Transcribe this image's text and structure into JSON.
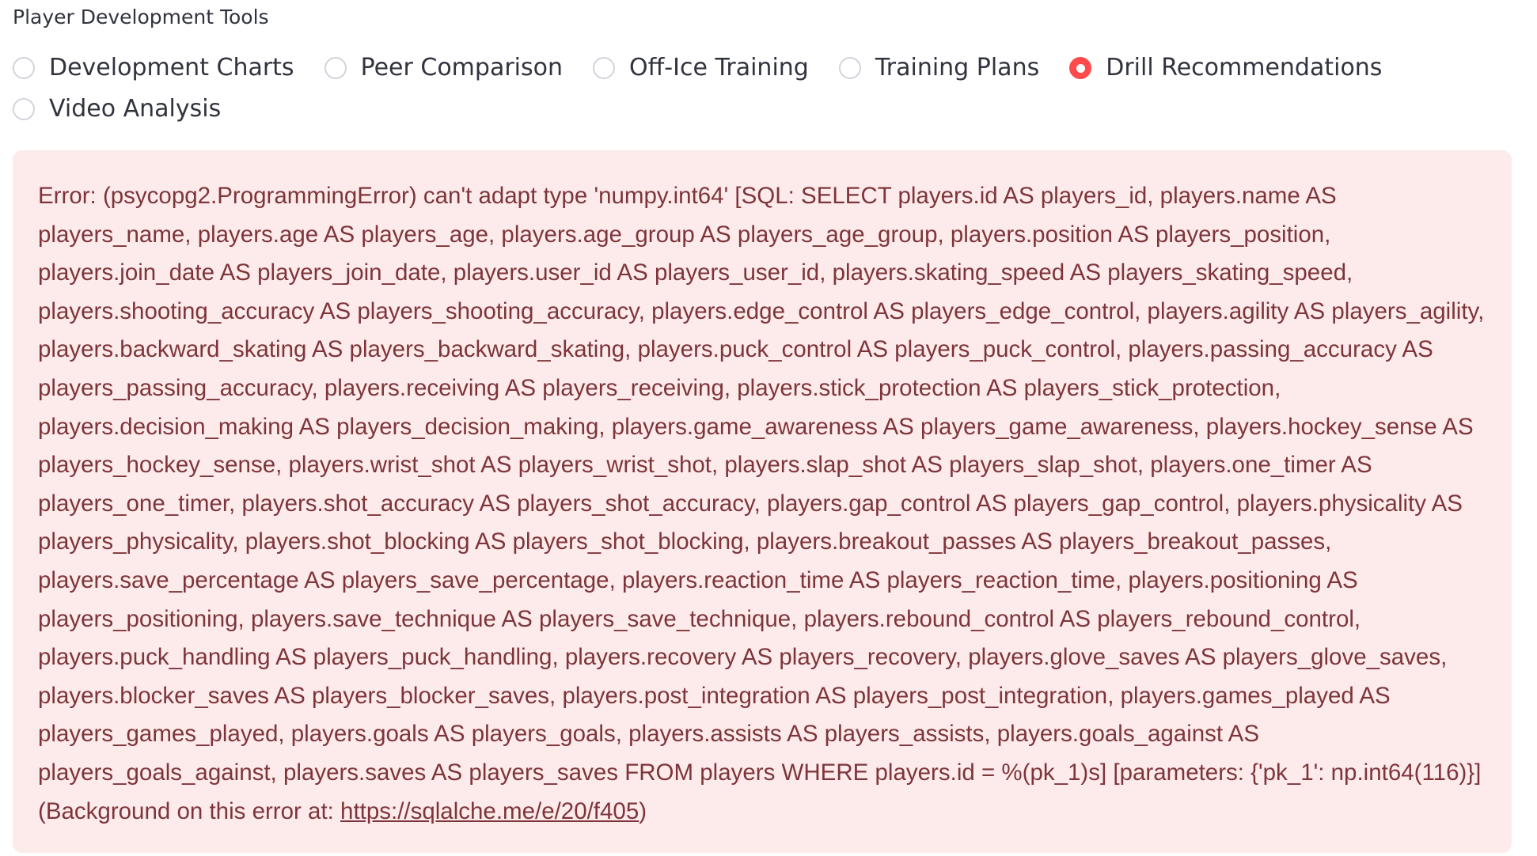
{
  "radio_group": {
    "label": "Player Development Tools",
    "options": [
      {
        "label": "Development Charts",
        "selected": false
      },
      {
        "label": "Peer Comparison",
        "selected": false
      },
      {
        "label": "Off-Ice Training",
        "selected": false
      },
      {
        "label": "Training Plans",
        "selected": false
      },
      {
        "label": "Drill Recommendations",
        "selected": true
      },
      {
        "label": "Video Analysis",
        "selected": false
      }
    ],
    "accent_color": "#ff4b4b"
  },
  "error": {
    "message": "Error: (psycopg2.ProgrammingError) can't adapt type 'numpy.int64' [SQL: SELECT players.id AS players_id, players.name AS players_name, players.age AS players_age, players.age_group AS players_age_group, players.position AS players_position, players.join_date AS players_join_date, players.user_id AS players_user_id, players.skating_speed AS players_skating_speed, players.shooting_accuracy AS players_shooting_accuracy, players.edge_control AS players_edge_control, players.agility AS players_agility, players.backward_skating AS players_backward_skating, players.puck_control AS players_puck_control, players.passing_accuracy AS players_passing_accuracy, players.receiving AS players_receiving, players.stick_protection AS players_stick_protection, players.decision_making AS players_decision_making, players.game_awareness AS players_game_awareness, players.hockey_sense AS players_hockey_sense, players.wrist_shot AS players_wrist_shot, players.slap_shot AS players_slap_shot, players.one_timer AS players_one_timer, players.shot_accuracy AS players_shot_accuracy, players.gap_control AS players_gap_control, players.physicality AS players_physicality, players.shot_blocking AS players_shot_blocking, players.breakout_passes AS players_breakout_passes, players.save_percentage AS players_save_percentage, players.reaction_time AS players_reaction_time, players.positioning AS players_positioning, players.save_technique AS players_save_technique, players.rebound_control AS players_rebound_control, players.puck_handling AS players_puck_handling, players.recovery AS players_recovery, players.glove_saves AS players_glove_saves, players.blocker_saves AS players_blocker_saves, players.post_integration AS players_post_integration, players.games_played AS players_games_played, players.goals AS players_goals, players.assists AS players_assists, players.goals_against AS players_goals_against, players.saves AS players_saves FROM players WHERE players.id = %(pk_1)s] [parameters: {'pk_1': np.int64(116)}] (Background on this error at: ",
    "link_text": "https://sqlalche.me/e/20/f405",
    "suffix": ")",
    "background_color": "#fdebeb",
    "text_color": "#7d353b"
  }
}
